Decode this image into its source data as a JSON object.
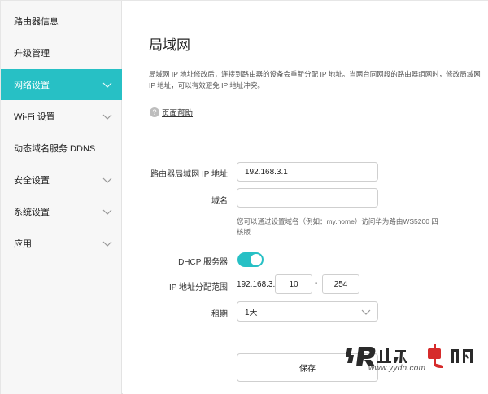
{
  "sidebar": {
    "items": [
      {
        "label": "路由器信息",
        "has_chevron": false,
        "active": false
      },
      {
        "label": "升级管理",
        "has_chevron": false,
        "active": false
      },
      {
        "label": "网络设置",
        "has_chevron": true,
        "active": true
      },
      {
        "label": "Wi-Fi 设置",
        "has_chevron": true,
        "active": false
      },
      {
        "label": "动态域名服务 DDNS",
        "has_chevron": false,
        "active": false
      },
      {
        "label": "安全设置",
        "has_chevron": true,
        "active": false
      },
      {
        "label": "系统设置",
        "has_chevron": true,
        "active": false
      },
      {
        "label": "应用",
        "has_chevron": true,
        "active": false
      }
    ]
  },
  "header": {
    "title": "局域网",
    "description": "局域网 IP 地址修改后，连接到路由器的设备会重新分配 IP 地址。当两台同网段的路由器组网时，修改局域网 IP 地址，可以有效避免 IP 地址冲突。",
    "help_label": "页面帮助",
    "help_icon": "?"
  },
  "form": {
    "lan_ip_label": "路由器局域网 IP 地址",
    "lan_ip_value": "192.168.3.1",
    "domain_label": "域名",
    "domain_value": "",
    "domain_hint": "您可以通过设置域名（例如：my.home）访问华为路由WS5200 四核版",
    "dhcp_label": "DHCP 服务器",
    "dhcp_enabled": true,
    "range_label": "IP 地址分配范围",
    "range_prefix": "192.168.3.",
    "range_start": "10",
    "range_dash": "-",
    "range_end": "254",
    "lease_label": "租期",
    "lease_value": "1天",
    "save_label": "保存"
  },
  "watermark": {
    "text": "业余电脑",
    "site": "www.yydn.com"
  },
  "colors": {
    "accent": "#27c0c5",
    "watermark_red": "#d62b2b"
  }
}
